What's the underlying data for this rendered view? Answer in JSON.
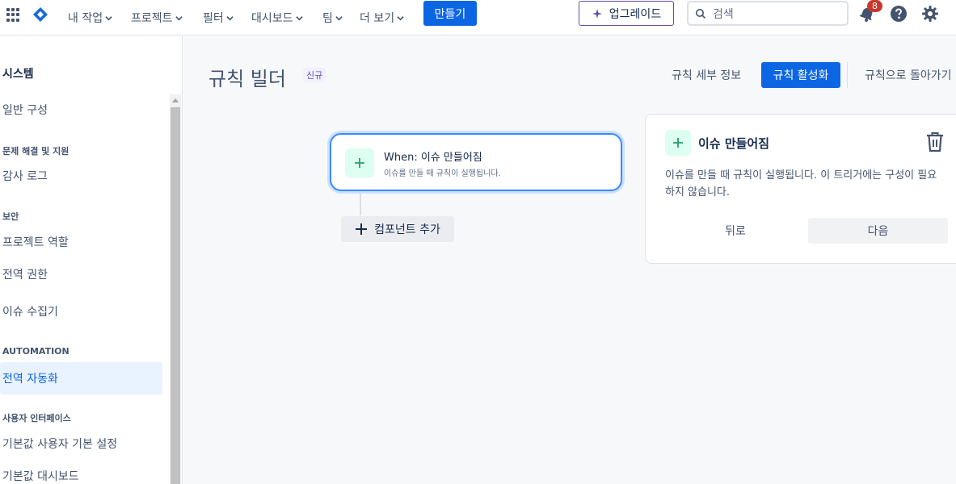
{
  "topnav": {
    "items": [
      "내 작업",
      "프로젝트",
      "필터",
      "대시보드",
      "팀",
      "더 보기"
    ],
    "create_label": "만들기",
    "upgrade_label": "업그레이드",
    "search_placeholder": "검색",
    "notification_count": "8"
  },
  "sidebar": {
    "title": "시스템",
    "items": [
      {
        "type": "item",
        "label": "일반 구성"
      },
      {
        "type": "section",
        "label": "문제 해결 및 지원"
      },
      {
        "type": "item",
        "label": "감사 로그"
      },
      {
        "type": "section",
        "label": "보안"
      },
      {
        "type": "item",
        "label": "프로젝트 역할"
      },
      {
        "type": "item",
        "label": "전역 권한"
      },
      {
        "type": "item",
        "label": "이슈 수집기"
      },
      {
        "type": "section",
        "label": "AUTOMATION"
      },
      {
        "type": "item",
        "label": "전역 자동화",
        "active": true
      },
      {
        "type": "section",
        "label": "사용자 인터페이스"
      },
      {
        "type": "item",
        "label": "기본값 사용자 기본 설정"
      },
      {
        "type": "item",
        "label": "기본값 대시보드"
      }
    ]
  },
  "header": {
    "title": "규칙 빌더",
    "badge": "신규",
    "details_link": "규칙 세부 정보",
    "enable_button": "규칙 활성화",
    "back_link": "규칙으로 돌아가기"
  },
  "canvas": {
    "trigger_title": "When: 이슈 만들어짐",
    "trigger_desc": "이슈를 만들 때 규칙이 실행됩니다.",
    "add_component": "컴포넌트 추가"
  },
  "panel": {
    "title": "이슈 만들어짐",
    "description": "이슈를 만들 때 규칙이 실행됩니다. 이 트리거에는 구성이 필요하지 않습니다.",
    "back_button": "뒤로",
    "next_button": "다음"
  },
  "colors": {
    "primary": "#0c66e4",
    "upgrade_border": "#5e4db2",
    "badge_red": "#c9372c",
    "trigger_green": "#22a06b"
  }
}
